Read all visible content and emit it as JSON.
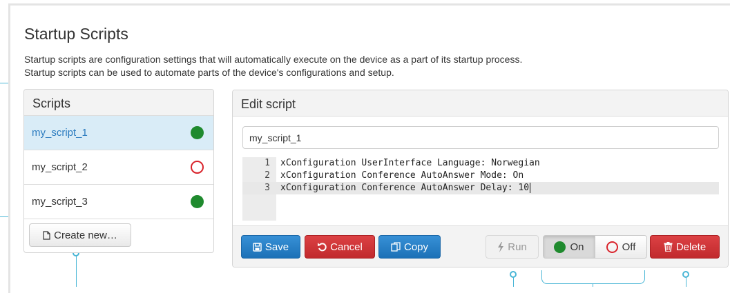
{
  "page": {
    "title": "Startup Scripts",
    "description_line1": "Startup scripts are configuration settings that will automatically execute on the device as a part of its startup process.",
    "description_line2": "Startup scripts can be used to automate parts of the device's configurations and setup."
  },
  "scripts_panel": {
    "title": "Scripts",
    "items": [
      {
        "name": "my_script_1",
        "status": "on",
        "active": true
      },
      {
        "name": "my_script_2",
        "status": "off",
        "active": false
      },
      {
        "name": "my_script_3",
        "status": "on",
        "active": false
      }
    ],
    "create_label": "Create new…",
    "create_icon": "file-icon"
  },
  "edit_panel": {
    "title": "Edit script",
    "script_name": "my_script_1",
    "code_lines": [
      {
        "num": "1",
        "text": "xConfiguration UserInterface Language: Norwegian"
      },
      {
        "num": "2",
        "text": "xConfiguration Conference AutoAnswer Mode: On"
      },
      {
        "num": "3",
        "text": "xConfiguration Conference AutoAnswer Delay: 10"
      }
    ],
    "active_line": 3,
    "buttons": {
      "save": "Save",
      "cancel": "Cancel",
      "copy": "Copy",
      "run": "Run",
      "on": "On",
      "off": "Off",
      "delete": "Delete"
    },
    "toggle_state": "on"
  },
  "colors": {
    "accent_blue": "#2b7bbf",
    "status_on": "#1f8a2e",
    "status_off": "#d9232b",
    "callout": "#49b6d6"
  }
}
